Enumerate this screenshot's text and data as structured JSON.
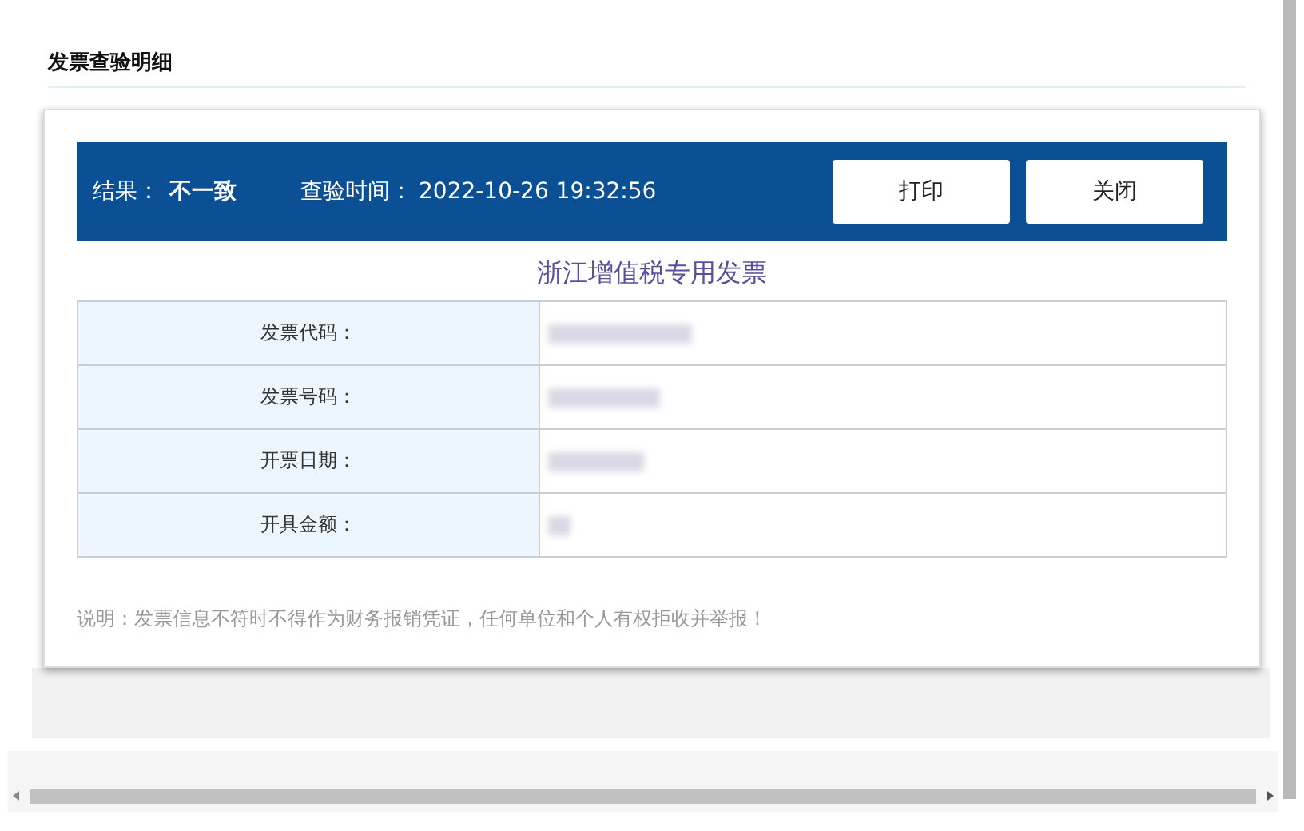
{
  "page_title": "发票查验明细",
  "result_bar": {
    "result_label": "结果：",
    "result_value": "不一致",
    "time_label": "查验时间：",
    "time_value": "2022-10-26 19:32:56"
  },
  "buttons": [
    {
      "label": "打印"
    },
    {
      "label": "关闭"
    }
  ],
  "invoice_title": "浙江增值税专用发票",
  "rows": [
    {
      "label": "发票代码："
    },
    {
      "label": "发票号码："
    },
    {
      "label": "开票日期："
    },
    {
      "label": "开具金额："
    }
  ],
  "note": "说明：发票信息不符时不得作为财务报销凭证，任何单位和个人有权拒收并举报！"
}
